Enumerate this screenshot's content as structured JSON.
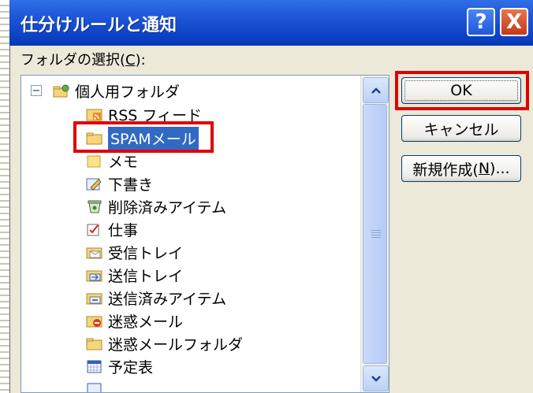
{
  "dialog": {
    "title": "仕分けルールと通知",
    "help_label": "?",
    "close_label": "X",
    "folder_label_prefix": "フォルダの選択(",
    "folder_label_key": "C",
    "folder_label_suffix": "):"
  },
  "tree": {
    "expander": "−",
    "items": [
      {
        "label": "個人用フォルダ",
        "icon": "personal-folders-icon"
      },
      {
        "label": "RSS フィード",
        "icon": "rss-feed-icon"
      },
      {
        "label": "SPAMメール",
        "icon": "folder-icon",
        "selected": true
      },
      {
        "label": "メモ",
        "icon": "notes-icon"
      },
      {
        "label": "下書き",
        "icon": "drafts-icon"
      },
      {
        "label": "削除済みアイテム",
        "icon": "deleted-items-icon"
      },
      {
        "label": "仕事",
        "icon": "tasks-icon"
      },
      {
        "label": "受信トレイ",
        "icon": "inbox-icon"
      },
      {
        "label": "送信トレイ",
        "icon": "outbox-icon"
      },
      {
        "label": "送信済みアイテム",
        "icon": "sent-items-icon"
      },
      {
        "label": "迷惑メール",
        "icon": "junk-mail-icon"
      },
      {
        "label": "迷惑メールフォルダ",
        "icon": "folder-icon"
      },
      {
        "label": "予定表",
        "icon": "calendar-icon"
      }
    ]
  },
  "buttons": {
    "ok": "OK",
    "cancel": "キャンセル",
    "new_prefix": "新規作成(",
    "new_key": "N",
    "new_suffix": ")..."
  },
  "colors": {
    "titlebar": "#0a3fc4",
    "highlight_border": "#e00000",
    "selection": "#316ac5"
  }
}
